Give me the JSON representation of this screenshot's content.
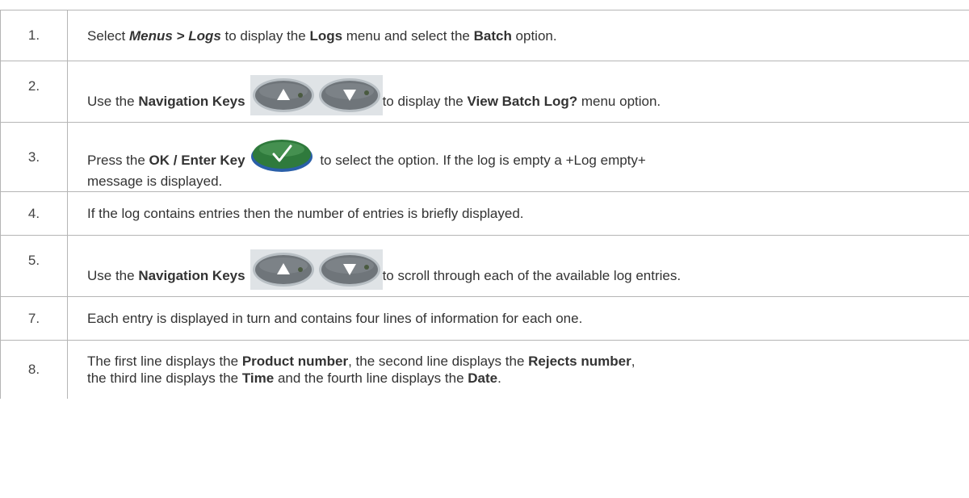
{
  "steps": [
    {
      "number": "1.",
      "parts": {
        "a": "Select ",
        "b": "Menus > Logs",
        "c": " to display the ",
        "d": "Logs",
        "e": " menu and select the ",
        "f": "Batch",
        "g": " option."
      }
    },
    {
      "number": "2.",
      "parts": {
        "a": "Use the ",
        "b": "Navigation Keys",
        "c": "to display the ",
        "d": "View Batch Log?",
        "e": " menu option."
      }
    },
    {
      "number": "3.",
      "parts": {
        "a": "Press the ",
        "b": "OK / Enter Key",
        "c": " to select the option. If the log is empty a +Log empty+",
        "d": "message is displayed."
      }
    },
    {
      "number": "4.",
      "parts": {
        "a": "If the log contains entries then the number of entries is briefly displayed."
      }
    },
    {
      "number": "5.",
      "parts": {
        "a": "Use the ",
        "b": "Navigation Keys",
        "c": "to scroll through each of the available log entries."
      }
    },
    {
      "number": "7.",
      "parts": {
        "a": "Each entry is displayed in turn and contains four lines of information for each one."
      }
    },
    {
      "number": "8.",
      "parts": {
        "a": "The first line displays the ",
        "b": "Product number",
        "c": ", the second line displays the ",
        "d": "Rejects number",
        "e": ",",
        "f": "the third line displays the ",
        "g": "Time",
        "h": " and the fourth line displays the ",
        "i": "Date",
        "j": "."
      }
    }
  ],
  "icons": {
    "up_key": "up-arrow-key-icon",
    "down_key": "down-arrow-key-icon",
    "ok_key": "checkmark-ok-key-icon"
  },
  "colors": {
    "key_gray": "#6f757a",
    "key_bezel": "#dfe3e6",
    "ok_green": "#2f7a3c",
    "ok_blue_edge": "#2a5fa8",
    "text": "#333333",
    "rule": "#b5b5b5"
  }
}
